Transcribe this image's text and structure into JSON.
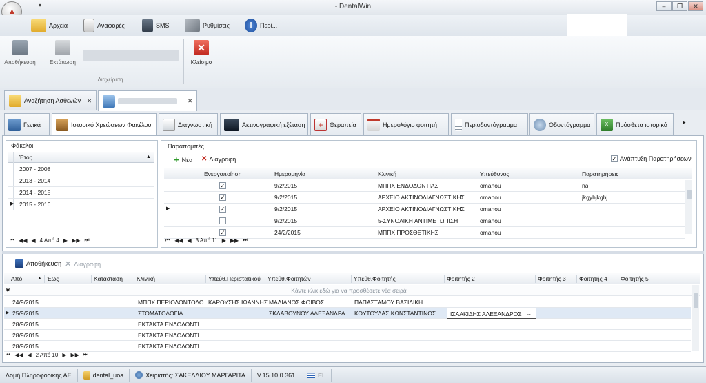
{
  "window": {
    "title": "- DentalWin",
    "minimize": "‒",
    "restore": "❐",
    "close": "✕"
  },
  "menu": {
    "items": [
      {
        "label": "Αρχεία",
        "icon": "folder-icon"
      },
      {
        "label": "Αναφορές",
        "icon": "report-icon"
      },
      {
        "label": "SMS",
        "icon": "phone-icon"
      },
      {
        "label": "Ρυθμίσεις",
        "icon": "tools-icon"
      },
      {
        "label": "Περί...",
        "icon": "info-icon"
      }
    ]
  },
  "ribbon": {
    "save_label": "Αποθήκευση",
    "print_label": "Εκτύπωση",
    "close_label": "Κλείσιμο",
    "group_label": "Διαχείριση"
  },
  "doc_tabs": {
    "search_label": "Αναζήτηση Ασθενών",
    "close_glyph": "✕"
  },
  "section_tabs": [
    "Γενικά",
    "Ιστορικό Χρεώσεων Φακέλου",
    "Διαγνωστική",
    "Ακτινογραφική εξέταση",
    "Θεραπεία",
    "Ημερολόγιο φοιτητή",
    "Περιοδοντόγραμμα",
    "Οδοντόγραμμα",
    "Πρόσθετα ιστορικά"
  ],
  "folders": {
    "title": "Φάκελοι",
    "column": "Έτος",
    "rows": [
      "2007 - 2008",
      "2013 - 2014",
      "2014 - 2015",
      "2015 - 2016"
    ],
    "pager": "4 Από 4"
  },
  "referrals": {
    "title": "Παραπομπές",
    "new_label": "Νέα",
    "delete_label": "Διαγραφή",
    "expand_label": "Ανάπτυξη Παρατηρήσεων",
    "columns": [
      "Ενεργοποίηση",
      "Ημερομηνία",
      "Κλινική",
      "Υπεύθυνος",
      "Παρατηρήσεις"
    ],
    "rows": [
      {
        "active": true,
        "date": "9/2/2015",
        "clinic": "ΜΠΠΧ ΕΝΔΟΔΟΝΤΙΑΣ",
        "owner": "omanou",
        "notes": "na"
      },
      {
        "active": true,
        "date": "9/2/2015",
        "clinic": "ΑΡΧΕΙΟ ΑΚΤΙΝΟΔΙΑΓΝΩΣΤΙΚΗΣ",
        "owner": "omanou",
        "notes": "jkgyhjkghj"
      },
      {
        "active": true,
        "date": "9/2/2015",
        "clinic": "ΑΡΧΕΙΟ ΑΚΤΙΝΟΔΙΑΓΝΩΣΤΙΚΗΣ",
        "owner": "omanou",
        "notes": ""
      },
      {
        "active": false,
        "date": "9/2/2015",
        "clinic": "5-ΣΥΝΟΛΙΚΗ ΑΝΤΙΜΕΤΩΠΙΣΗ",
        "owner": "omanou",
        "notes": ""
      },
      {
        "active": true,
        "date": "24/2/2015",
        "clinic": "ΜΠΠΧ ΠΡΟΣΘΕΤΙΚΗΣ",
        "owner": "omanou",
        "notes": ""
      }
    ],
    "pager": "3 Από 11"
  },
  "bottom": {
    "save_label": "Αποθήκευση",
    "delete_label": "Διαγραφή",
    "columns": [
      "Από",
      "Έως",
      "Κατάσταση",
      "Κλινική",
      "Υπεύθ.Περιστατικού",
      "Υπεύθ.Φοιτητών",
      "Υπεύθ.Φοιτητής",
      "Φοιτητής 2",
      "Φοιτητής 3",
      "Φοιτητής 4",
      "Φοιτητής 5"
    ],
    "new_row_hint": "Κάντε κλικ εδώ για να προσθέσετε νέα σειρά",
    "rows": [
      {
        "from": "24/9/2015",
        "clinic": "ΜΠΠΧ ΠΕΡΙΟΔΟΝΤΟΛΟ...",
        "case": "ΚΑΡΟΥΣΗΣ ΙΩΑΝΝΗΣ",
        "students_sup": "ΜΑΔΙΑΝΟΣ ΦΟΙΒΟΣ",
        "student": "ΠΑΠΑΣΤΑΜΟΥ ΒΑΣΙΛΙΚΗ",
        "student2": ""
      },
      {
        "from": "25/9/2015",
        "clinic": "ΣΤΟΜΑΤΟΛΟΓΙΑ",
        "case": "",
        "students_sup": "ΣΚΛΑΒΟΥΝΟΥ ΑΛΕΞΑΝΔΡΑ",
        "student": "ΚΟΥΤΟΥΛΑΣ ΚΩΝΣΤΑΝΤΙΝΟΣ",
        "student2": "ΙΣΑΑΚΙΔΗΣ ΑΛΕΞΑΝΔΡΟΣ"
      },
      {
        "from": "28/9/2015",
        "clinic": "ΕΚΤΑΚΤΑ ΕΝΔΟΔΟΝΤΙ...",
        "case": "",
        "students_sup": "",
        "student": "",
        "student2": ""
      },
      {
        "from": "28/9/2015",
        "clinic": "ΕΚΤΑΚΤΑ ΕΝΔΟΔΟΝΤΙ...",
        "case": "",
        "students_sup": "",
        "student": "",
        "student2": ""
      },
      {
        "from": "28/9/2015",
        "clinic": "ΕΚΤΑΚΤΑ ΕΝΔΟΔΟΝΤΙ...",
        "case": "",
        "students_sup": "",
        "student": "",
        "student2": ""
      }
    ],
    "pager": "2 Από 10",
    "ellipsis": "···"
  },
  "status": {
    "company": "Δομή Πληροφορικής ΑΕ",
    "db": "dental_uoa",
    "user": "Χειριστής: ΣΑΚΕΛΛΙΟΥ ΜΑΡΓΑΡΙΤΑ",
    "version": "V.15.10.0.361",
    "lang": "EL"
  }
}
